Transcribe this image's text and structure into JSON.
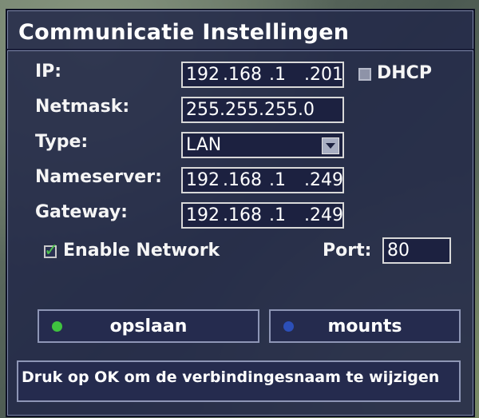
{
  "title": "Communicatie Instellingen",
  "ip": {
    "label": "IP:",
    "octets": [
      "192",
      ".168",
      ".1",
      ".201"
    ]
  },
  "dhcp": {
    "label": "DHCP",
    "checked": false
  },
  "netmask": {
    "label": "Netmask:",
    "value": "255.255.255.0"
  },
  "type": {
    "label": "Type:",
    "value": "LAN"
  },
  "nameserver": {
    "label": "Nameserver:",
    "octets": [
      "192",
      ".168",
      ".1",
      ".249"
    ]
  },
  "gateway": {
    "label": "Gateway:",
    "octets": [
      "192",
      ".168",
      ".1",
      ".249"
    ]
  },
  "enable_network": {
    "label": "Enable Network",
    "checked": true
  },
  "port": {
    "label": "Port:",
    "value": "80"
  },
  "buttons": {
    "save": {
      "label": "opslaan",
      "dot_color": "#3fc33f"
    },
    "mounts": {
      "label": "mounts",
      "dot_color": "#2c4fb8"
    }
  },
  "status_text": "Druk op OK om de verbindingesnaam te wijzigen"
}
